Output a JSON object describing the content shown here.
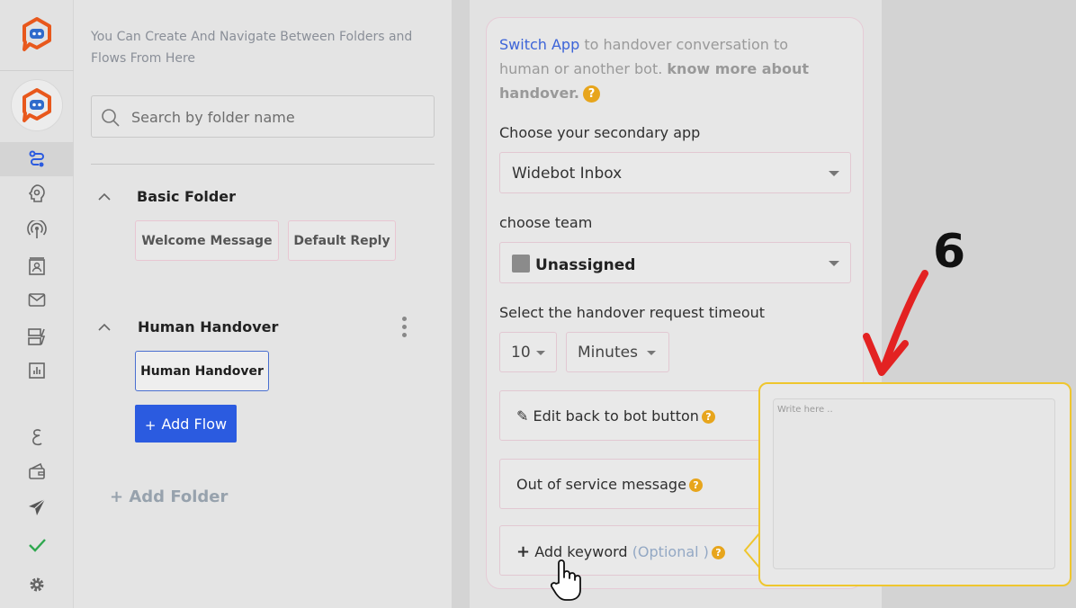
{
  "folders_panel": {
    "hint": "You Can Create And Navigate Between Folders and Flows From Here",
    "search_placeholder": "Search by folder name",
    "folders": [
      {
        "title": "Basic Folder",
        "flows": [
          "Welcome Message",
          "Default Reply"
        ]
      },
      {
        "title": "Human Handover",
        "flows": [
          "Human Handover"
        ]
      }
    ],
    "add_flow_label": "Add Flow",
    "add_folder_label": "+ Add Folder"
  },
  "handover_panel": {
    "intro_link": "Switch App",
    "intro_text": " to handover conversation to human or another bot. ",
    "intro_bold": "know more about handover.",
    "secondary_app_label": "Choose your secondary app",
    "secondary_app_value": "Widebot Inbox",
    "team_label": "choose team",
    "team_value": "Unassigned",
    "timeout_label": "Select the handover request timeout",
    "timeout_value": "10",
    "timeout_unit": "Minutes",
    "edit_back_label": "Edit back to bot button",
    "out_of_service_label": "Out of service message",
    "add_keyword_label": "Add keyword",
    "add_keyword_optional": "(Optional )"
  },
  "keyword_popover": {
    "placeholder": "Write here .."
  },
  "annotation": {
    "step_number": "6"
  },
  "colors": {
    "primary_blue": "#2b5be0",
    "brand_orange": "#e8581c",
    "help_yellow": "#e7a51c",
    "popover_border": "#efc62e",
    "annotation_red": "#e32222"
  }
}
